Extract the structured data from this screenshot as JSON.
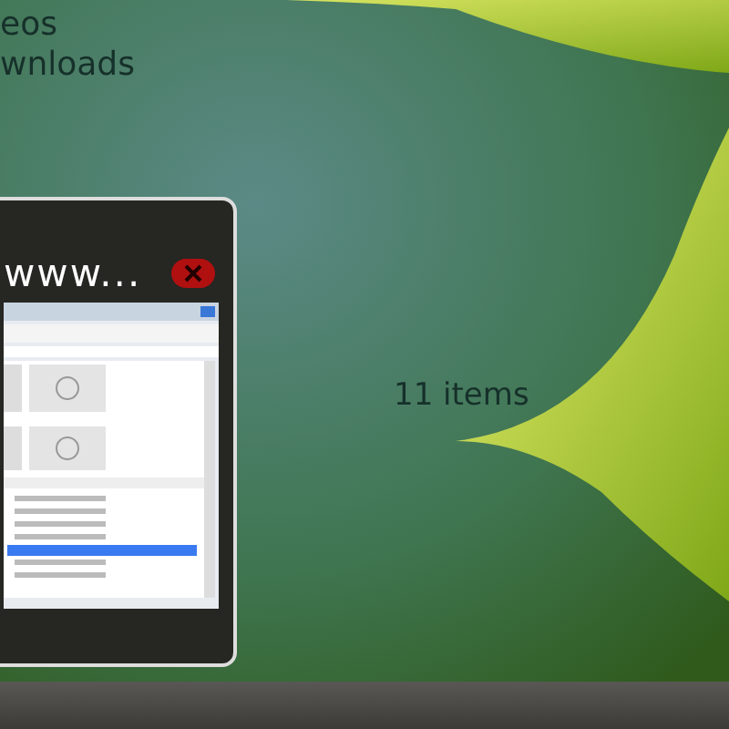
{
  "desktop_labels": [
    "eos",
    "wnloads"
  ],
  "folder_status": "11 items",
  "preview": {
    "title": "www..."
  }
}
